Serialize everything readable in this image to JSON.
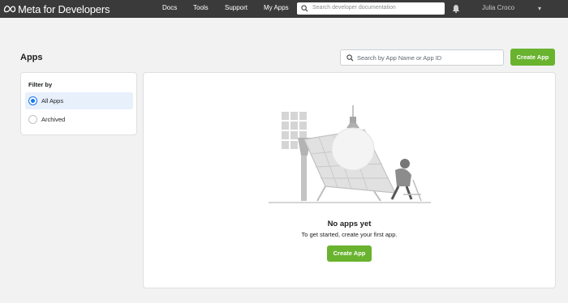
{
  "nav": {
    "brand": "Meta for Developers",
    "links": [
      "Docs",
      "Tools",
      "Support",
      "My Apps"
    ],
    "search_placeholder": "Search developer documentation",
    "user_name": "Julia Croco",
    "icons": [
      "meta-logo-icon",
      "search-icon",
      "bell-icon",
      "chevron-down-icon"
    ]
  },
  "page": {
    "title": "Apps",
    "search_placeholder": "Search by App Name or App ID",
    "create_label": "Create App"
  },
  "filter": {
    "title": "Filter by",
    "options": [
      {
        "label": "All Apps",
        "selected": true
      },
      {
        "label": "Archived",
        "selected": false
      }
    ]
  },
  "empty_state": {
    "title": "No apps yet",
    "subtitle": "To get started, create your first app.",
    "button_label": "Create App"
  },
  "colors": {
    "nav_bg": "#3a3a3a",
    "page_bg": "#f2f2f2",
    "accent_green": "#69b32f",
    "selected_bg": "#e7f0fb",
    "radio_blue": "#1877f2"
  }
}
